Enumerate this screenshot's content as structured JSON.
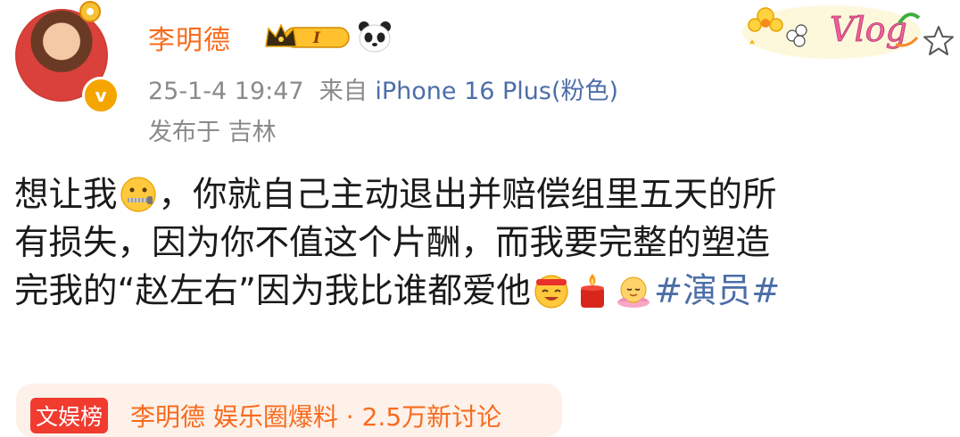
{
  "author": {
    "name": "李明德",
    "vip_badge_text": "I"
  },
  "meta": {
    "timestamp": "25-1-4 19:47",
    "source_prefix": "来自",
    "source_device": "iPhone 16 Plus(粉色)",
    "location": "发布于 吉林"
  },
  "post": {
    "line1_a": "想让我",
    "line1_b": "，你就自己主动退出并赔偿组里五天的所",
    "line2": "有损失，因为你不值这个片酬，而我要完整的塑造",
    "line3_a": "完我的“赵左右”因为我比谁都爱他",
    "hashtag": "#演员#"
  },
  "topic": {
    "tag": "文娱榜",
    "text": "李明德 娱乐圈爆料 · 2.5万新讨论"
  },
  "decor": {
    "vlog_text": "Vlog"
  },
  "colors": {
    "username": "#f86b1d",
    "link": "#4c6ea8",
    "meta": "#8a8a8a"
  }
}
